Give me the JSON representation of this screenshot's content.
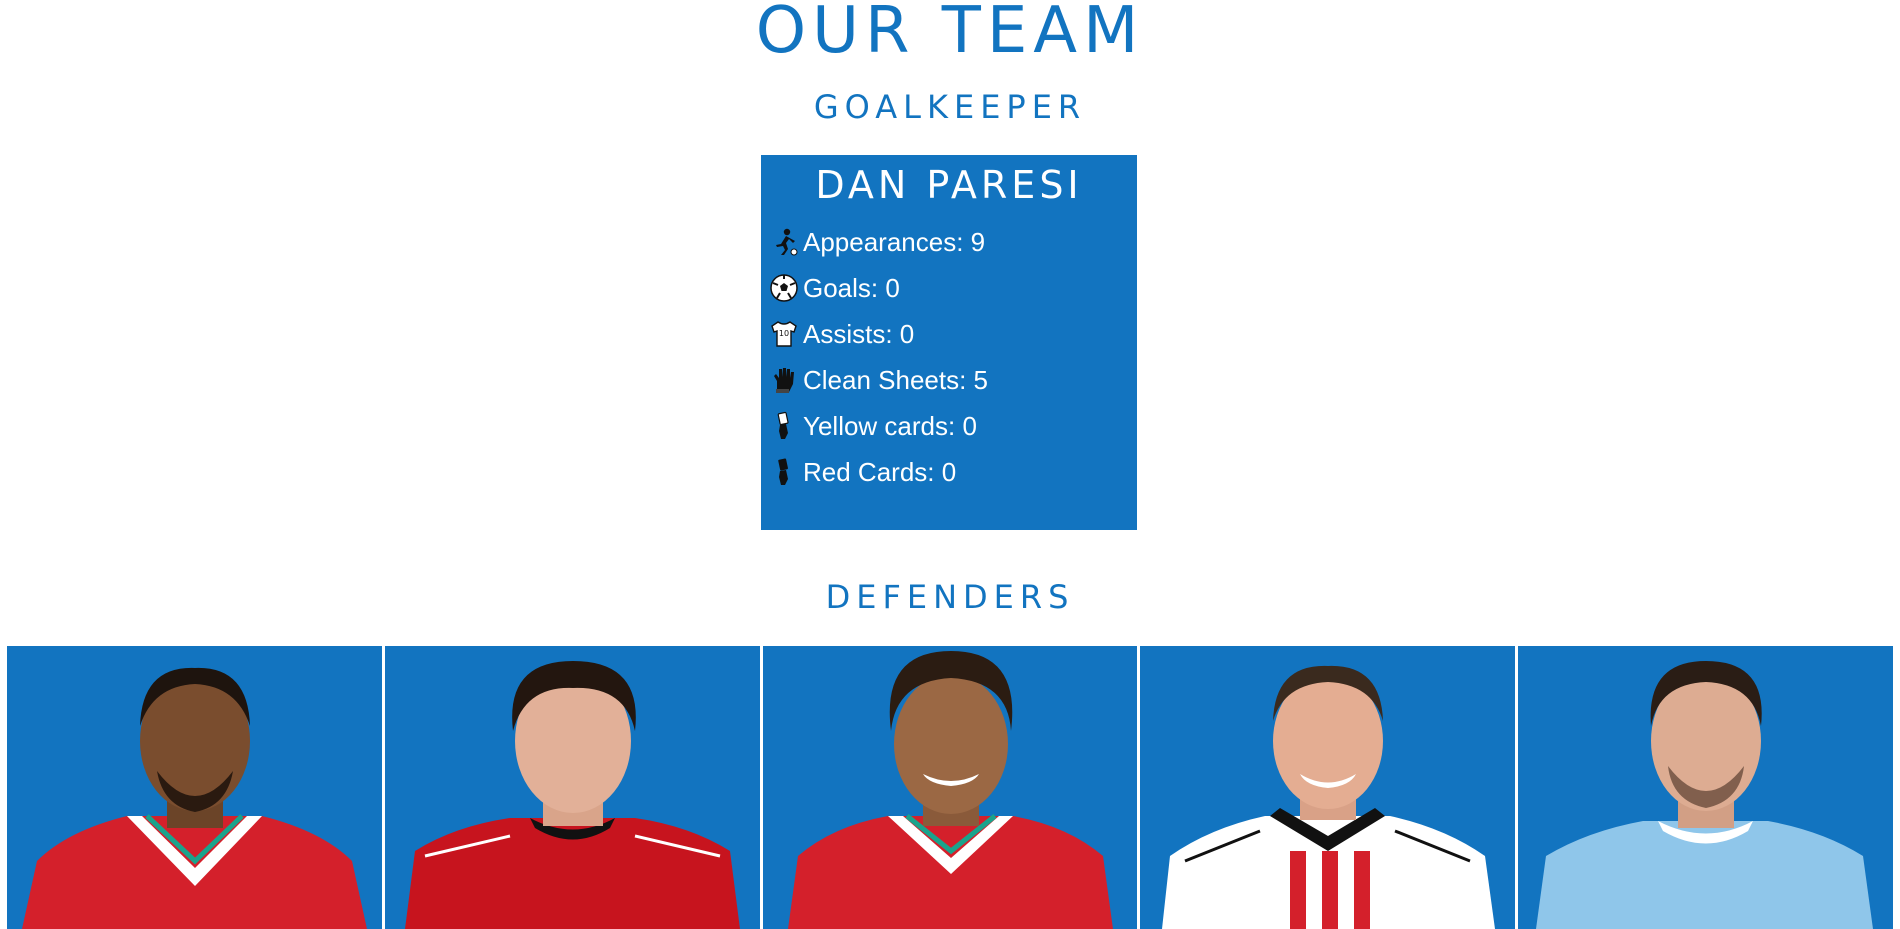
{
  "page": {
    "title": "OUR TEAM"
  },
  "goalkeeper": {
    "section_title": "GOALKEEPER",
    "name": "DAN PARESI",
    "stats": [
      {
        "icon": "player-kick-icon",
        "text": "Appearances: 9"
      },
      {
        "icon": "soccer-ball-icon",
        "text": "Goals: 0"
      },
      {
        "icon": "jersey-icon",
        "text": "Assists: 0"
      },
      {
        "icon": "goalkeeper-glove-icon",
        "text": "Clean Sheets: 5"
      },
      {
        "icon": "yellow-card-icon",
        "text": "Yellow cards: 0"
      },
      {
        "icon": "red-card-icon",
        "text": "Red Cards: 0"
      }
    ]
  },
  "defenders": {
    "section_title": "DEFENDERS",
    "players": [
      {
        "kit": "red-white-collar"
      },
      {
        "kit": "red-striped"
      },
      {
        "kit": "red-white-collar"
      },
      {
        "kit": "red-white-striped"
      },
      {
        "kit": "sky-blue"
      }
    ]
  },
  "colors": {
    "accent": "#1274c0",
    "background": "#ffffff",
    "card_text": "#ffffff"
  }
}
